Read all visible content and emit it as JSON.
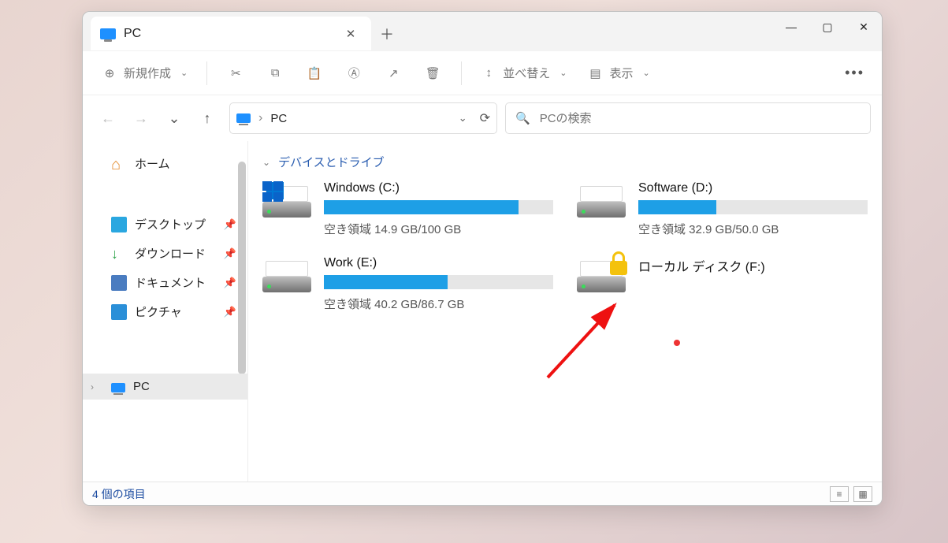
{
  "window": {
    "tab_title": "PC",
    "toolbar": {
      "new_label": "新規作成",
      "sort_label": "並べ替え",
      "view_label": "表示"
    },
    "breadcrumb": {
      "root": "PC"
    },
    "search": {
      "placeholder": "PCの検索"
    }
  },
  "sidebar": {
    "home": "ホーム",
    "items": [
      {
        "label": "デスクトップ",
        "icon": "desktop"
      },
      {
        "label": "ダウンロード",
        "icon": "download"
      },
      {
        "label": "ドキュメント",
        "icon": "document"
      },
      {
        "label": "ピクチャ",
        "icon": "picture"
      }
    ],
    "pc_label": "PC"
  },
  "main": {
    "group_title": "デバイスとドライブ",
    "drives": [
      {
        "name": "Windows (C:)",
        "free_text": "空き領域 14.9 GB/100 GB",
        "fill_pct": 85,
        "icon": "windows",
        "locked": false
      },
      {
        "name": "Software (D:)",
        "free_text": "空き領域 32.9 GB/50.0 GB",
        "fill_pct": 34,
        "icon": "drive",
        "locked": false
      },
      {
        "name": "Work (E:)",
        "free_text": "空き領域 40.2 GB/86.7 GB",
        "fill_pct": 54,
        "icon": "drive",
        "locked": false
      },
      {
        "name": "ローカル ディスク (F:)",
        "free_text": "",
        "fill_pct": 0,
        "icon": "drive",
        "locked": true
      }
    ]
  },
  "status": {
    "text": "4 個の項目"
  }
}
